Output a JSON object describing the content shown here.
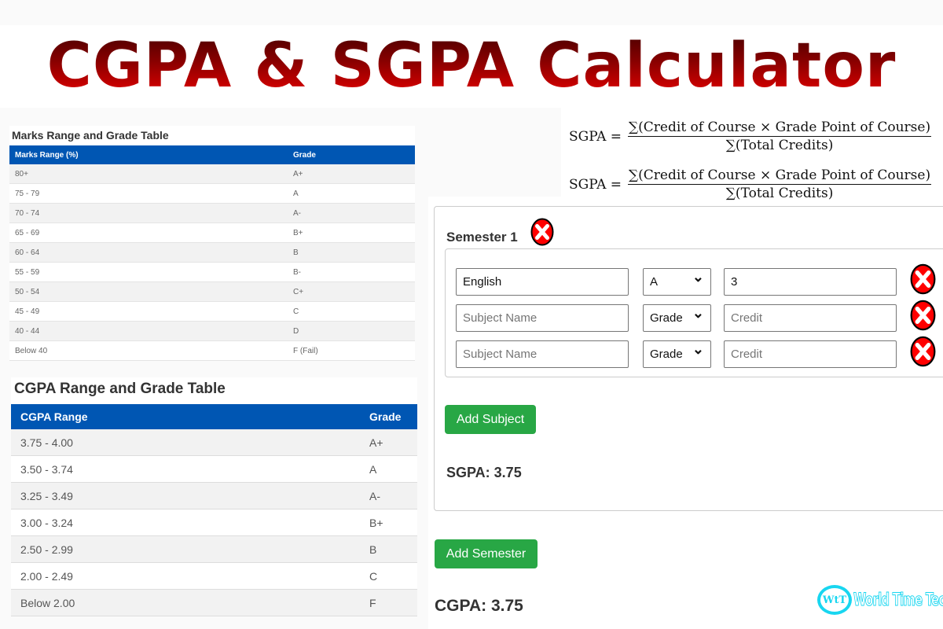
{
  "header": {
    "title": "CGPA & SGPA Calculator"
  },
  "marks_table": {
    "title": "Marks Range and Grade Table",
    "columns": [
      "Marks Range (%)",
      "Grade"
    ],
    "rows": [
      [
        "80+",
        "A+"
      ],
      [
        "75 - 79",
        "A"
      ],
      [
        "70 - 74",
        "A-"
      ],
      [
        "65 - 69",
        "B+"
      ],
      [
        "60 - 64",
        "B"
      ],
      [
        "55 - 59",
        "B-"
      ],
      [
        "50 - 54",
        "C+"
      ],
      [
        "45 - 49",
        "C"
      ],
      [
        "40 - 44",
        "D"
      ],
      [
        "Below 40",
        "F (Fail)"
      ]
    ]
  },
  "cgpa_table": {
    "title": "CGPA Range and Grade Table",
    "columns": [
      "CGPA Range",
      "Grade"
    ],
    "rows": [
      [
        "3.75 - 4.00",
        "A+"
      ],
      [
        "3.50 - 3.74",
        "A"
      ],
      [
        "3.25 - 3.49",
        "A-"
      ],
      [
        "3.00 - 3.24",
        "B+"
      ],
      [
        "2.50 - 2.99",
        "B"
      ],
      [
        "2.00 - 2.49",
        "C"
      ],
      [
        "Below 2.00",
        "F"
      ]
    ]
  },
  "formulas": [
    {
      "lhs": "SGPA =",
      "numerator": "∑(Credit of Course × Grade Point of Course)",
      "denominator": "∑(Total Credits)"
    },
    {
      "lhs": "SGPA =",
      "numerator": "∑(Credit of Course × Grade Point of Course)",
      "denominator": "∑(Total Credits)"
    }
  ],
  "semester": {
    "title": "Semester 1",
    "remove_icon": "close-circle-icon",
    "subjects": [
      {
        "name_value": "English",
        "name_placeholder": "Subject Name",
        "grade_value": "A",
        "credit_value": "3",
        "credit_placeholder": "Credit"
      },
      {
        "name_value": "",
        "name_placeholder": "Subject Name",
        "grade_value": "Grade",
        "credit_value": "",
        "credit_placeholder": "Credit"
      },
      {
        "name_value": "",
        "name_placeholder": "Subject Name",
        "grade_value": "Grade",
        "credit_value": "",
        "credit_placeholder": "Credit"
      }
    ],
    "add_subject_label": "Add Subject",
    "sgpa_text": "SGPA: 3.75"
  },
  "add_semester_label": "Add Semester",
  "cgpa_text": "CGPA: 3.75",
  "logo": {
    "mark": "WtT",
    "text": "World Time Tech"
  },
  "colors": {
    "table_header": "#0056b3",
    "button": "#28a745",
    "remove_icon": "#ff0000",
    "title_gradient_top": "#3a0000",
    "title_gradient_bottom": "#ff0000",
    "logo": "#18d6f0"
  }
}
